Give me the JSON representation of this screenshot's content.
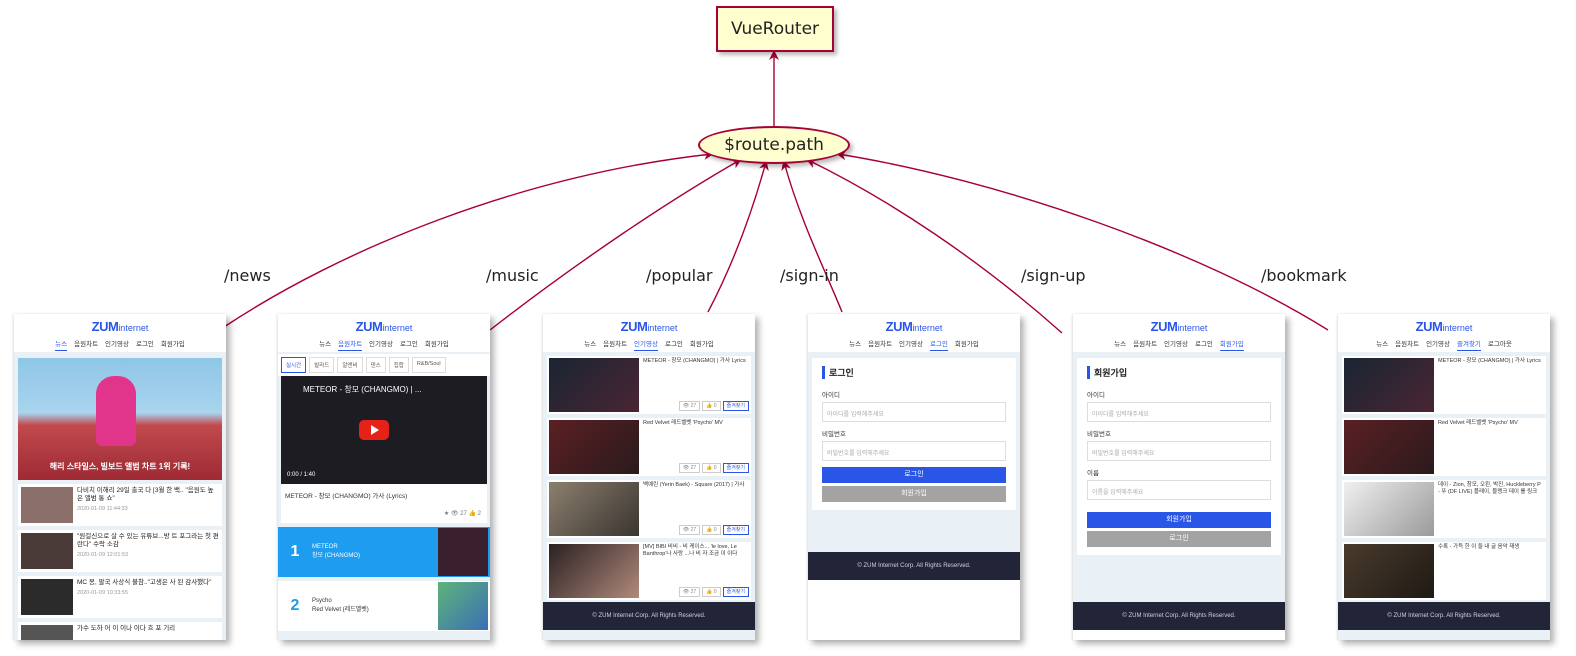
{
  "nodes": {
    "router": "VueRouter",
    "route_path": "$route.path"
  },
  "edges": [
    {
      "label": "/news"
    },
    {
      "label": "/music"
    },
    {
      "label": "/popular"
    },
    {
      "label": "/sign-in"
    },
    {
      "label": "/sign-up"
    },
    {
      "label": "/bookmark"
    }
  ],
  "app": {
    "logo_main": "ZUM",
    "logo_sub": "internet",
    "nav": [
      "뉴스",
      "음원차트",
      "인기영상",
      "로그인",
      "회원가입"
    ],
    "nav_bookmark": [
      "뉴스",
      "음원차트",
      "인기영상",
      "즐겨찾기",
      "로그아웃"
    ],
    "footer": "© ZUM Internet Corp. All Rights Reserved."
  },
  "news": {
    "hero_title": "해리 스타일스, 빌보드 앨범 차트 1위 기록!",
    "items": [
      {
        "title": "다비치 이해리 29일 출국 다 [3월 한 백.. \"음원도 높은 앨범 통 쇼\"",
        "date": "2020-01-09 11:44:33"
      },
      {
        "title": "\"원걸신으로 살 수 있는 유튜브...방 트 포그라는 첫 편란다\" 수락 소감",
        "date": "2020-01-09 12:01:53"
      },
      {
        "title": "MC 몽, 팔국 사상식 불참..\"고생은 사 된 감사했다\"",
        "date": "2020-01-09 10:33:55"
      },
      {
        "title": "가수 도하 어 이 이나 이다 흐 포 기리"
      }
    ]
  },
  "music": {
    "chips": [
      "실시간",
      "발라드",
      "알앤비",
      "댄스",
      "힙합",
      "R&B/Soul"
    ],
    "video_title": "METEOR - 창모 (CHANGMO) | ...",
    "video_time": "0:00 / 1:40",
    "caption": "METEOR - 창모 (CHANGMO) 가사 (Lyrics)",
    "stats": "★  👁 27  👍 2",
    "ranks": [
      {
        "num": "1",
        "title": "METEOR",
        "artist": "창모 (CHANGMO)"
      },
      {
        "num": "2",
        "title": "Psycho",
        "artist": "Red Velvet (레드벨벳)"
      }
    ]
  },
  "popular": {
    "items": [
      "METEOR - 창모 (CHANGMO) | 가사 Lyrics",
      "Red Velvet 레드벨벳 'Psycho' MV",
      "백예린 (Yerin Baek) - Square (2017) | 가사",
      "[MV] BIBI 비비 - 비 케이스... 'le love, Le Banthrop'나 사랑 ...나 비 자 조금 이 이다"
    ],
    "btns": [
      "👁 27",
      "👍 0",
      "즐겨찾기"
    ]
  },
  "signin": {
    "title": "로그인",
    "id_label": "아이디",
    "id_placeholder": "아이디를 입력해주세요",
    "pw_label": "비밀번호",
    "pw_placeholder": "비밀번호를 입력해주세요",
    "submit": "로그인",
    "alt": "회원가입"
  },
  "signup": {
    "title": "회원가입",
    "id_label": "아이디",
    "id_placeholder": "아이디를 입력해주세요",
    "pw_label": "비밀번호",
    "pw_placeholder": "비밀번호를 입력해주세요",
    "name_label": "이름",
    "name_placeholder": "이름을 입력해주세요",
    "submit": "회원가입",
    "alt": "로그인"
  },
  "bookmark": {
    "items": [
      "METEOR - 창모 (CHANGMO) | 가사 Lyrics",
      "Red Velvet 레드벨벳 'Psycho' MV",
      "데이 - Zion, 창모, 오왼, 박진, Huckleberry P - 뚜 (DF LIVE) 플레이, 블랭크 데이 를 링크",
      "수록 - 가득 한 이 들 내 글 음악 재생"
    ]
  }
}
